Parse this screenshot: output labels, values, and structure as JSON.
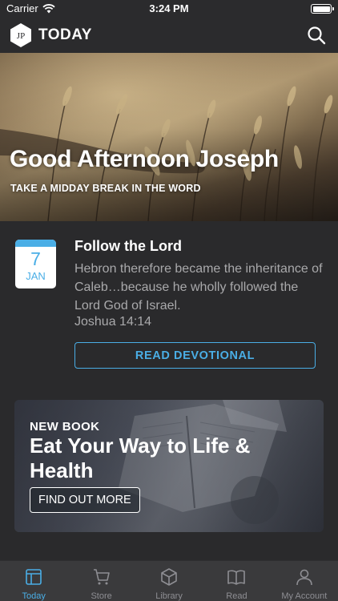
{
  "status": {
    "carrier": "Carrier",
    "time": "3:24 PM"
  },
  "nav": {
    "logo_text": "JP",
    "title": "TODAY",
    "icon": "search-icon"
  },
  "hero": {
    "greeting": "Good Afternoon Joseph",
    "subtitle": "TAKE A MIDDAY BREAK IN THE WORD"
  },
  "devotional": {
    "date_day": "7",
    "date_month": "JAN",
    "title": "Follow the Lord",
    "text": "Hebron therefore became the inheritance of Caleb…because he wholly followed the Lord God of Israel.",
    "reference": "Joshua 14:14",
    "button_label": "READ DEVOTIONAL"
  },
  "promo": {
    "kicker": "NEW BOOK",
    "title": "Eat Your Way to Life & Health",
    "button_label": "FIND OUT MORE"
  },
  "tabs": [
    {
      "label": "Today",
      "icon": "today-icon",
      "active": true
    },
    {
      "label": "Store",
      "icon": "cart-icon",
      "active": false
    },
    {
      "label": "Library",
      "icon": "box-icon",
      "active": false
    },
    {
      "label": "Read",
      "icon": "book-icon",
      "active": false
    },
    {
      "label": "My Account",
      "icon": "person-icon",
      "active": false
    }
  ],
  "colors": {
    "accent": "#4aaee6",
    "background": "#2a2a2c",
    "tabbar": "#3a3a3c"
  }
}
